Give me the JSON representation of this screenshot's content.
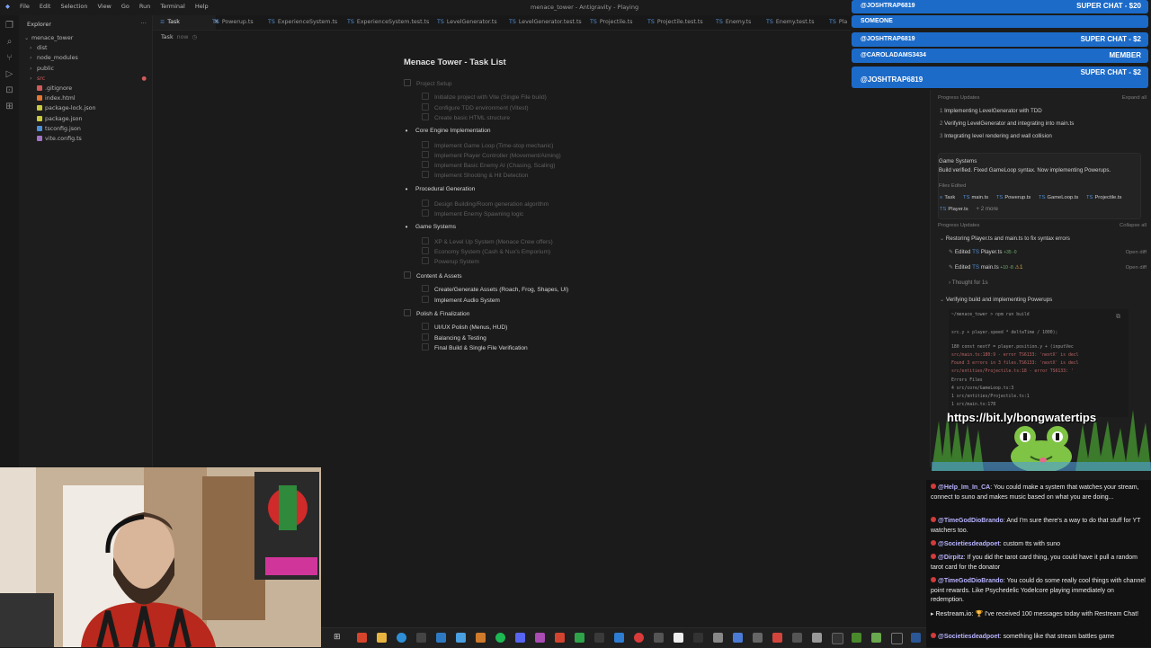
{
  "window": {
    "title": "menace_tower - Antigravity - Playing",
    "menu": [
      "File",
      "Edit",
      "Selection",
      "View",
      "Go",
      "Run",
      "Terminal",
      "Help"
    ]
  },
  "explorer": {
    "header": "Explorer",
    "root": "menace_tower",
    "items": [
      {
        "label": "dist",
        "type": "folder"
      },
      {
        "label": "node_modules",
        "type": "folder"
      },
      {
        "label": "public",
        "type": "folder"
      },
      {
        "label": "src",
        "type": "folder",
        "error": true
      },
      {
        "label": ".gitignore",
        "type": "file",
        "color": "#d25b5b"
      },
      {
        "label": "index.html",
        "type": "file",
        "color": "#e37933"
      },
      {
        "label": "package-lock.json",
        "type": "file",
        "color": "#cbcb41"
      },
      {
        "label": "package.json",
        "type": "file",
        "color": "#cbcb41"
      },
      {
        "label": "tsconfig.json",
        "type": "file",
        "color": "#4f8fd6"
      },
      {
        "label": "vite.config.ts",
        "type": "file",
        "color": "#a074c4"
      }
    ]
  },
  "tabs": [
    {
      "label": "Task",
      "active": true
    },
    {
      "label": "Powerup.ts"
    },
    {
      "label": "ExperienceSystem.ts"
    },
    {
      "label": "ExperienceSystem.test.ts"
    },
    {
      "label": "LevelGenerator.ts"
    },
    {
      "label": "LevelGenerator.test.ts"
    },
    {
      "label": "Projectile.ts"
    },
    {
      "label": "Projectile.test.ts"
    },
    {
      "label": "Enemy.ts"
    },
    {
      "label": "Enemy.test.ts"
    },
    {
      "label": "Pla"
    }
  ],
  "breadcrumb": {
    "label": "Task",
    "time": "now"
  },
  "task_list": {
    "title": "Menace Tower - Task List",
    "sections": [
      {
        "label": "Project Setup",
        "state": "done",
        "items": [
          {
            "label": "Initialize project with Vite (Single File build)",
            "state": "done"
          },
          {
            "label": "Configure TDD environment (Vitest)",
            "state": "done"
          },
          {
            "label": "Create basic HTML structure",
            "state": "done"
          }
        ]
      },
      {
        "label": "Core Engine Implementation",
        "state": "prog",
        "items": [
          {
            "label": "Implement Game Loop (Time-stop mechanic)",
            "state": "done"
          },
          {
            "label": "Implement Player Controller (Movement/Aiming)",
            "state": "done"
          },
          {
            "label": "Implement Basic Enemy AI (Chasing, Scaling)",
            "state": "done"
          },
          {
            "label": "Implement Shooting & Hit Detection",
            "state": "done"
          }
        ]
      },
      {
        "label": "Procedural Generation",
        "state": "prog",
        "items": [
          {
            "label": "Design Building/Room generation algorithm",
            "state": "done"
          },
          {
            "label": "Implement Enemy Spawning logic",
            "state": "done"
          }
        ]
      },
      {
        "label": "Game Systems",
        "state": "prog",
        "items": [
          {
            "label": "XP & Level Up System (Menace Crew offers)",
            "state": "done"
          },
          {
            "label": "Economy System (Cash & Nux's Emporium)",
            "state": "done"
          },
          {
            "label": "Powerup System",
            "state": "done"
          }
        ]
      },
      {
        "label": "Content & Assets",
        "state": "todo",
        "items": [
          {
            "label": "Create/Generate Assets (Roach, Frog, Shapes, UI)",
            "state": "todo"
          },
          {
            "label": "Implement Audio System",
            "state": "todo"
          }
        ]
      },
      {
        "label": "Polish & Finalization",
        "state": "todo",
        "items": [
          {
            "label": "UI/UX Polish (Menus, HUD)",
            "state": "todo"
          },
          {
            "label": "Balancing & Testing",
            "state": "todo"
          },
          {
            "label": "Final Build & Single File Verification",
            "state": "todo"
          }
        ]
      }
    ]
  },
  "agent_panel": {
    "progress_label_1": "Progress Updates",
    "expand_all": "Expand all",
    "updates_1": [
      "Implementing LevelGenerator with TDD",
      "Verifying LevelGenerator and integrating into main.ts",
      "Integrating level rendering and wall collision"
    ],
    "game_systems_title": "Game Systems",
    "game_systems_text": "Build verified. Fixed GameLoop syntax. Now implementing Powerups.",
    "files_edited_label": "Files Edited",
    "files_edited": [
      "Task",
      "main.ts",
      "Powerup.ts",
      "GameLoop.ts",
      "Projectile.ts",
      "Player.ts"
    ],
    "files_more": "+ 2 more",
    "progress_label_2": "Progress Updates",
    "collapse_all": "Collapse all",
    "step_a": "Restoring Player.ts and main.ts to fix syntax errors",
    "edit_1": {
      "action": "Edited",
      "file": "Player.ts",
      "diff": "+35 -0",
      "open": "Open diff"
    },
    "edit_2": {
      "action": "Edited",
      "file": "main.ts",
      "diff": "+10 -8",
      "warn": "1",
      "open": "Open diff"
    },
    "thought": "Thought for 1s",
    "step_b": "Verifying build and implementing Powerups",
    "terminal": [
      "~/menace_tower > npm run build",
      "",
      "src.y + player.speed * deltaTime / 1000);",
      "",
      "180   const nextY = player.position.y + (inputVec",
      "src/main.ts:180:9 - error TS6133: 'nextX' is decl",
      "Found 3 errors in 3 files.TS6133: 'nextX' is decl",
      "src/entities/Projectile.ts:18 - error TS6133: '",
      "Errors  Files",
      "     4  src/core/GameLoop.ts:3",
      "     1  src/entities/Projectile.ts:1",
      "     1  src/main.ts:178"
    ]
  },
  "alerts": [
    {
      "user": "@JOSHTRAP6819",
      "text": "SUPER CHAT - $20",
      "color": "#1c6bc9"
    },
    {
      "user": "SOMEONE",
      "text": "",
      "color": "#1c6bc9"
    },
    {
      "user": "@JOSHTRAP6819",
      "text": "SUPER CHAT - $2",
      "color": "#1c6bc9"
    },
    {
      "user": "@CAROLADAMS3434",
      "text": "MEMBER",
      "color": "#1c6bc9"
    },
    {
      "user": "@JOSHTRAP6819",
      "text": "SUPER CHAT - $2",
      "color": "#1c6bc9"
    }
  ],
  "banner": {
    "url": "https://bit.ly/bongwatertips"
  },
  "chat": [
    {
      "name": "@Help_Im_In_CA",
      "text": "You could make a system that watches your stream, connect to suno and makes music based on what you are doing..."
    },
    {
      "name": "@TimeGodDioBrando",
      "text": "And I'm sure there's a way to do that stuff for YT watchers too."
    },
    {
      "name": "@Societiesdeadpoet",
      "text": "custom tts with suno"
    },
    {
      "name": "@Dirpitz",
      "text": "If you did the tarot card thing, you could have it pull a random tarot card for the donator"
    },
    {
      "name": "@TimeGodDioBrando",
      "text": "You could do some really cool things with channel point rewards. Like Psychedelic Yodelcore playing immediately on redemption."
    },
    {
      "name": "Restream.io",
      "text": "I've received 100 messages today with Restream Chat!",
      "bot": true
    },
    {
      "name": "@Societiesdeadpoet",
      "text": "something like that stream battles game"
    }
  ],
  "taskbar_icons": [
    "start-icon",
    "search-icon",
    "chrome-icon",
    "files-icon",
    "edge-icon",
    "terminal-icon",
    "vscode-icon",
    "explorer-icon",
    "photos-icon",
    "spotify-icon",
    "discord-icon",
    "obs-icon",
    "steam-icon",
    "app-icon",
    "app-icon",
    "app-icon",
    "app-icon",
    "app-icon",
    "app-icon",
    "app-icon",
    "app-icon",
    "app-icon",
    "app-icon",
    "app-icon",
    "app-icon",
    "app-icon",
    "app-icon",
    "app-icon",
    "app-icon",
    "app-icon",
    "app-icon",
    "app-icon"
  ],
  "colors": {
    "accent": "#4f8fd6",
    "error": "#d25b5b",
    "alert": "#1c6bc9",
    "chat_name": "#b8b3ff"
  }
}
